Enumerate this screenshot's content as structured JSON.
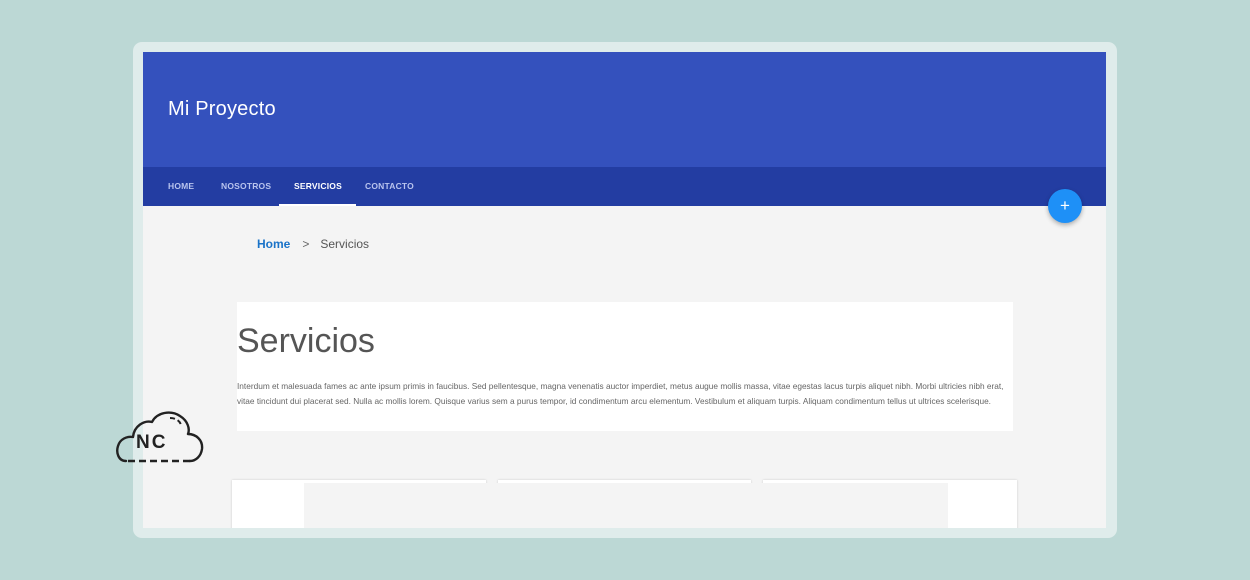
{
  "header": {
    "brand": "Mi Proyecto"
  },
  "nav": {
    "items": [
      {
        "label": "HOME",
        "active": false
      },
      {
        "label": "NOSOTROS",
        "active": false
      },
      {
        "label": "SERVICIOS",
        "active": true
      },
      {
        "label": "CONTACTO",
        "active": false
      }
    ]
  },
  "fab": {
    "label": "+"
  },
  "breadcrumb": {
    "home": "Home",
    "separator": ">",
    "current": "Servicios"
  },
  "main": {
    "title": "Servicios",
    "body": "Interdum et malesuada fames ac ante ipsum primis in faucibus. Sed pellentesque, magna venenatis auctor imperdiet, metus augue mollis massa, vitae egestas lacus turpis aliquet nibh. Morbi ultricies nibh erat, vitae tincidunt dui placerat sed. Nulla ac mollis lorem. Quisque varius sem a purus tempor, id condimentum arcu elementum. Vestibulum et aliquam turpis. Aliquam condimentum tellus ut ultrices scelerisque."
  },
  "logo": {
    "text": "NC",
    "icon": "cloud-icon"
  },
  "colors": {
    "background": "#bcd8d5",
    "header": "#3451bd",
    "navbar": "#233da2",
    "fab": "#1e90f7",
    "link": "#1a73c8"
  }
}
